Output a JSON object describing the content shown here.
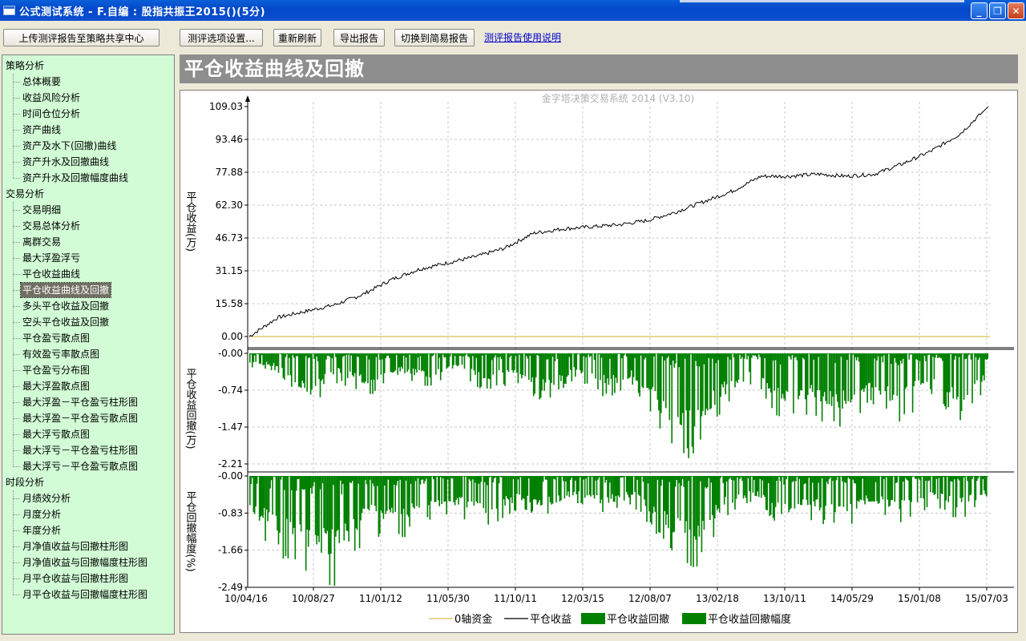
{
  "window": {
    "title": "公式测试系统 - F.自编 : 股指共振王2015()(5分)"
  },
  "toolbar": {
    "upload_label": "上传测评报告至策略共享中心",
    "options_label": "测评选项设置...",
    "refresh_label": "重新刷新",
    "export_label": "导出报告",
    "switch_label": "切换到简易报告",
    "help_link": "测评报告使用说明"
  },
  "sidebar": {
    "groups": [
      {
        "label": "策略分析",
        "items": [
          "总体概要",
          "收益风险分析",
          "时间仓位分析",
          "资产曲线",
          "资产及水下(回撤)曲线",
          "资产升水及回撤曲线",
          "资产升水及回撤幅度曲线"
        ]
      },
      {
        "label": "交易分析",
        "items": [
          "交易明细",
          "交易总体分析",
          "离群交易",
          "最大浮盈浮亏",
          "平仓收益曲线",
          "平仓收益曲线及回撤",
          "多头平仓收益及回撤",
          "空头平仓收益及回撤",
          "平仓盈亏散点图",
          "有效盈亏率散点图",
          "平仓盈亏分布图",
          "最大浮盈散点图",
          "最大浮盈－平仓盈亏柱形图",
          "最大浮盈－平仓盈亏散点图",
          "最大浮亏散点图",
          "最大浮亏－平仓盈亏柱形图",
          "最大浮亏－平仓盈亏散点图"
        ]
      },
      {
        "label": "时段分析",
        "items": [
          "月绩效分析",
          "月度分析",
          "年度分析",
          "月净值收益与回撤柱形图",
          "月净值收益与回撤幅度柱形图",
          "月平仓收益与回撤柱形图",
          "月平仓收益与回撤幅度柱形图"
        ]
      }
    ],
    "selected": "平仓收益曲线及回撤"
  },
  "panel": {
    "title": "平仓收益曲线及回撤"
  },
  "chart_data": {
    "type": "line",
    "watermark": "金字塔决策交易系统 2014 (V3.10)",
    "x_tick_labels": [
      "10/04/16",
      "10/08/27",
      "11/01/12",
      "11/05/30",
      "11/10/11",
      "12/03/15",
      "12/08/07",
      "13/02/18",
      "13/10/11",
      "14/05/29",
      "15/01/08",
      "15/07/03"
    ],
    "panels": [
      {
        "ylabel": "平仓收益(万)",
        "yticks": [
          "109.03",
          "93.46",
          "77.88",
          "62.30",
          "46.73",
          "31.15",
          "15.58",
          "0.00"
        ],
        "ylim": [
          0,
          109.03
        ],
        "series": [
          {
            "name": "平仓收益",
            "color": "#000000",
            "values": [
              0,
              9,
              12,
              15,
              20,
              27,
              32,
              35,
              38,
              42,
              49,
              51,
              52,
              53,
              55,
              59,
              64,
              69,
              76,
              76,
              77,
              76,
              77,
              82,
              88,
              96,
              109
            ]
          },
          {
            "name": "0轴资金",
            "color": "#d8c050",
            "values": [
              0,
              0
            ]
          }
        ]
      },
      {
        "ylabel": "平仓收益回撤(万)",
        "yticks": [
          "-0.00",
          "-0.74",
          "-1.47",
          "-2.21"
        ],
        "ylim": [
          -2.21,
          0
        ],
        "series": [
          {
            "name": "平仓收益回撤",
            "color": "#008000",
            "values": [
              -0.3,
              -0.4,
              -1.2,
              -0.6,
              -0.9,
              -0.5,
              -0.7,
              -0.4,
              -0.8,
              -0.6,
              -1.1,
              -0.5,
              -0.9,
              -0.7,
              -1.8,
              -2.2,
              -1.2,
              -0.6,
              -1.4,
              -1.3,
              -1.6,
              -1.0,
              -1.5,
              -0.8,
              -1.4,
              -0.7
            ]
          }
        ]
      },
      {
        "ylabel": "平仓回撤幅度(%)",
        "yticks": [
          "-0.00",
          "-0.83",
          "-1.66",
          "-2.49"
        ],
        "ylim": [
          -2.49,
          0
        ],
        "series": [
          {
            "name": "平仓收益回撤幅度",
            "color": "#008000",
            "values": [
              -1.2,
              -1.8,
              -2.4,
              -2.5,
              -1.3,
              -1.5,
              -1.0,
              -0.9,
              -1.2,
              -0.8,
              -1.0,
              -0.6,
              -0.9,
              -0.7,
              -1.6,
              -2.2,
              -1.0,
              -0.6,
              -1.2,
              -1.0,
              -1.3,
              -0.8,
              -1.1,
              -0.7,
              -1.0,
              -0.6
            ]
          }
        ]
      }
    ],
    "legend": {
      "position": "bottom",
      "items": [
        {
          "label": "0轴资金",
          "style": "line",
          "color": "#d8c050"
        },
        {
          "label": "平仓收益",
          "style": "line",
          "color": "#000000"
        },
        {
          "label": "平仓收益回撤",
          "style": "box",
          "color": "#008000"
        },
        {
          "label": "平仓收益回撤幅度",
          "style": "box",
          "color": "#008000"
        }
      ]
    }
  }
}
